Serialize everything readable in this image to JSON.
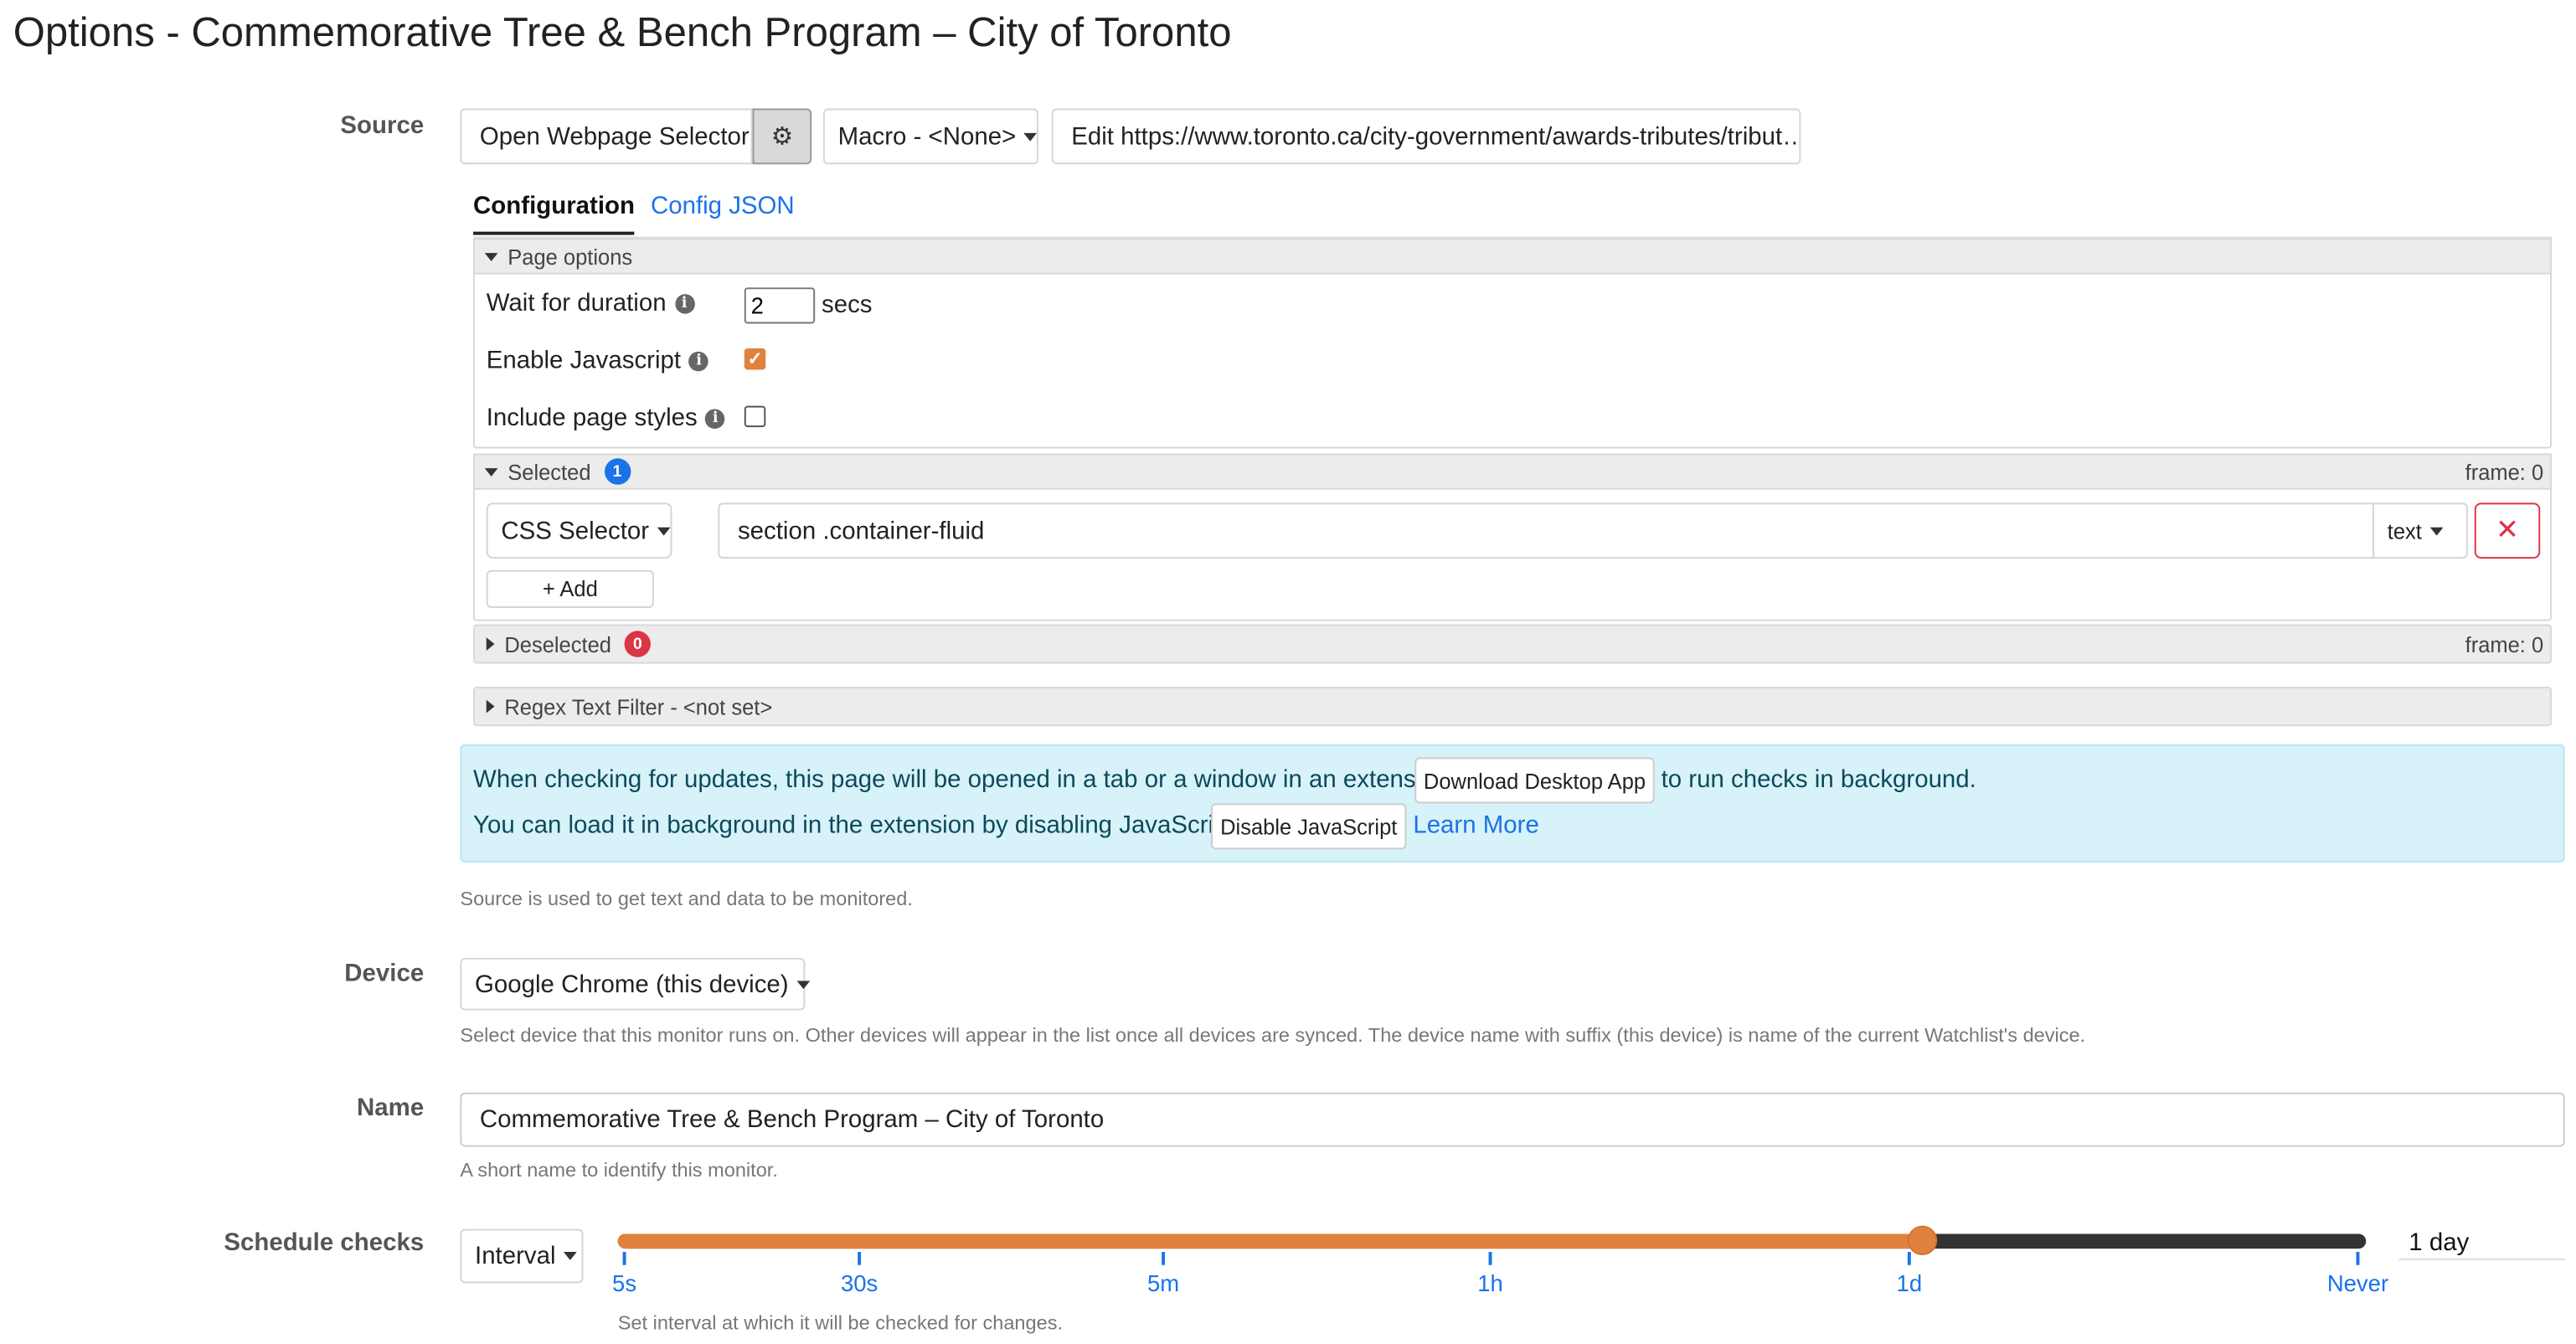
{
  "page_title": "Options - Commemorative Tree & Bench Program – City of Toronto",
  "source": {
    "label": "Source",
    "open_selector_label": "Open Webpage Selector",
    "macro_label": "Macro - <None>",
    "edit_url_label": "Edit https://www.toronto.ca/city-government/awards-tributes/tribut…",
    "tabs": [
      {
        "label": "Configuration",
        "active": true
      },
      {
        "label": "Config JSON",
        "active": false
      }
    ],
    "page_options": {
      "header": "Page options",
      "wait_label": "Wait for duration",
      "wait_value": "2",
      "wait_unit": "secs",
      "enable_js_label": "Enable Javascript",
      "enable_js_checked": true,
      "include_styles_label": "Include page styles",
      "include_styles_checked": false
    },
    "selected": {
      "header": "Selected",
      "count": "1",
      "frame": "frame: 0",
      "selector_type": "CSS Selector",
      "selector_value": "section .container-fluid",
      "output_type": "text",
      "add_label": "+ Add"
    },
    "deselected": {
      "header": "Deselected",
      "count": "0",
      "frame": "frame: 0"
    },
    "regex": {
      "header": "Regex Text Filter - <not set>"
    },
    "notice": {
      "line1_text": "When checking for updates, this page will be opened in a tab or a window in an extension.",
      "download_label": "Download Desktop App",
      "line1_suffix": "to run checks in background.",
      "line2_text": "You can load it in background in the extension by disabling JavaScript.",
      "disable_js_label": "Disable JavaScript",
      "learn_more_label": "Learn More"
    },
    "help": "Source is used to get text and data to be monitored."
  },
  "device": {
    "label": "Device",
    "value": "Google Chrome (this device)",
    "help": "Select device that this monitor runs on. Other devices will appear in the list once all devices are synced. The device name with suffix (this device) is name of the current Watchlist's device."
  },
  "name": {
    "label": "Name",
    "value": "Commemorative Tree & Bench Program – City of Toronto",
    "help": "A short name to identify this monitor."
  },
  "schedule": {
    "label": "Schedule checks",
    "mode": "Interval",
    "ticks": [
      "5s",
      "30s",
      "5m",
      "1h",
      "1d",
      "Never"
    ],
    "selected_tick": "1d",
    "value_display": "1 day",
    "help": "Set interval at which it will be checked for changes."
  },
  "colors": {
    "accent": "#e0823d",
    "link": "#1a73e8",
    "notice_bg": "#d7f2f9",
    "badge_blue": "#1a73e8",
    "badge_red": "#dc3545",
    "danger": "#dc3545"
  }
}
